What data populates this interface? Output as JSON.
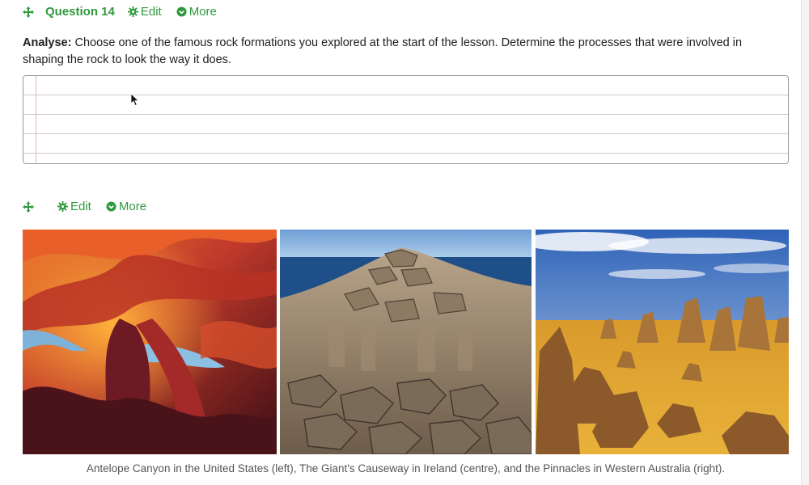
{
  "question_block": {
    "title": "Question 14",
    "edit_label": "Edit",
    "more_label": "More",
    "prompt_bold": "Analyse:",
    "prompt_text": " Choose one of the famous rock formations you explored at the start of the lesson. Determine the processes that were involved in shaping the rock to look the way it does.",
    "answer_value": ""
  },
  "media_block": {
    "edit_label": "Edit",
    "more_label": "More",
    "caption": "Antelope Canyon in the United States (left), The Giant's Causeway in Ireland (centre), and the Pinnacles in Western Australia (right).",
    "images": [
      {
        "name": "antelope-canyon-photo"
      },
      {
        "name": "giants-causeway-photo"
      },
      {
        "name": "pinnacles-photo"
      }
    ]
  },
  "colors": {
    "accent": "#2e9a3c",
    "caption_text": "#555555",
    "answer_border": "#9a9a9a"
  },
  "icons": {
    "move": "move-arrows-icon",
    "edit": "gear-icon",
    "more": "chevron-circle-icon"
  }
}
